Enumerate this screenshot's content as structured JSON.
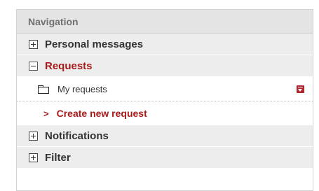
{
  "navigation": {
    "header": "Navigation",
    "sections": [
      {
        "label": "Personal messages",
        "state": "collapsed",
        "toggle_icon": "expand-plus-icon"
      },
      {
        "label": "Requests",
        "state": "expanded",
        "toggle_icon": "collapse-minus-icon",
        "items": [
          {
            "label": "My requests",
            "icon": "folder-icon",
            "action_icon": "dropdown-menu-icon"
          }
        ],
        "link": {
          "prefix": ">",
          "label": "Create new request"
        }
      },
      {
        "label": "Notifications",
        "state": "collapsed",
        "toggle_icon": "expand-plus-icon"
      },
      {
        "label": "Filter",
        "state": "collapsed",
        "toggle_icon": "expand-plus-icon"
      }
    ]
  },
  "colors": {
    "header_bg": "#e4e4e4",
    "section_bg": "#ededed",
    "accent_red": "#a71b1b",
    "text_dark": "#333333",
    "header_text": "#707070"
  }
}
